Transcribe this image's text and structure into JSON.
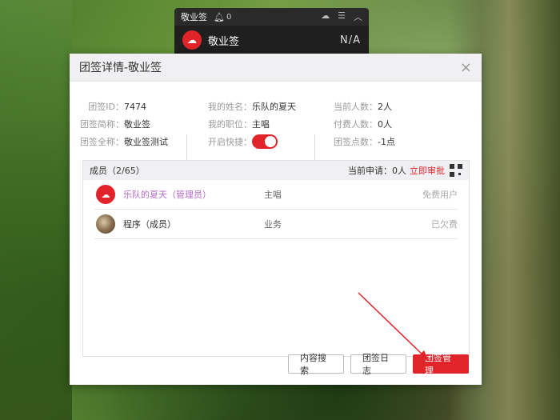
{
  "mini": {
    "title": "敬业签",
    "bell_count": "0",
    "app_name": "敬业签",
    "status": "N/A"
  },
  "dialog": {
    "title": "团签详情-敬业签",
    "close": "×",
    "info": {
      "col1": [
        {
          "label": "团签ID：",
          "value": "7474"
        },
        {
          "label": "团签简称：",
          "value": "敬业签"
        },
        {
          "label": "团签全称：",
          "value": "敬业签测试"
        }
      ],
      "col2": [
        {
          "label": "我的姓名：",
          "value": "乐队的夏天"
        },
        {
          "label": "我的职位：",
          "value": "主唱"
        },
        {
          "label": "开启快捷：",
          "value": ""
        }
      ],
      "col3": [
        {
          "label": "当前人数：",
          "value": "2人"
        },
        {
          "label": "付费人数：",
          "value": "0人"
        },
        {
          "label": "团签点数：",
          "value": "-1点"
        }
      ]
    },
    "members": {
      "header": "成员（2/65）",
      "apply_label": "当前申请：0人",
      "approve_link": "立即审批",
      "rows": [
        {
          "name": "乐队的夏天（管理员）",
          "role": "主唱",
          "status": "免费用户"
        },
        {
          "name": "程序（成员）",
          "role": "业务",
          "status": "已欠费"
        }
      ]
    },
    "buttons": {
      "search": "内容搜索",
      "log": "团签日志",
      "manage": "团签管理"
    }
  },
  "colors": {
    "accent": "#e0242a",
    "admin_name": "#b469c8"
  }
}
